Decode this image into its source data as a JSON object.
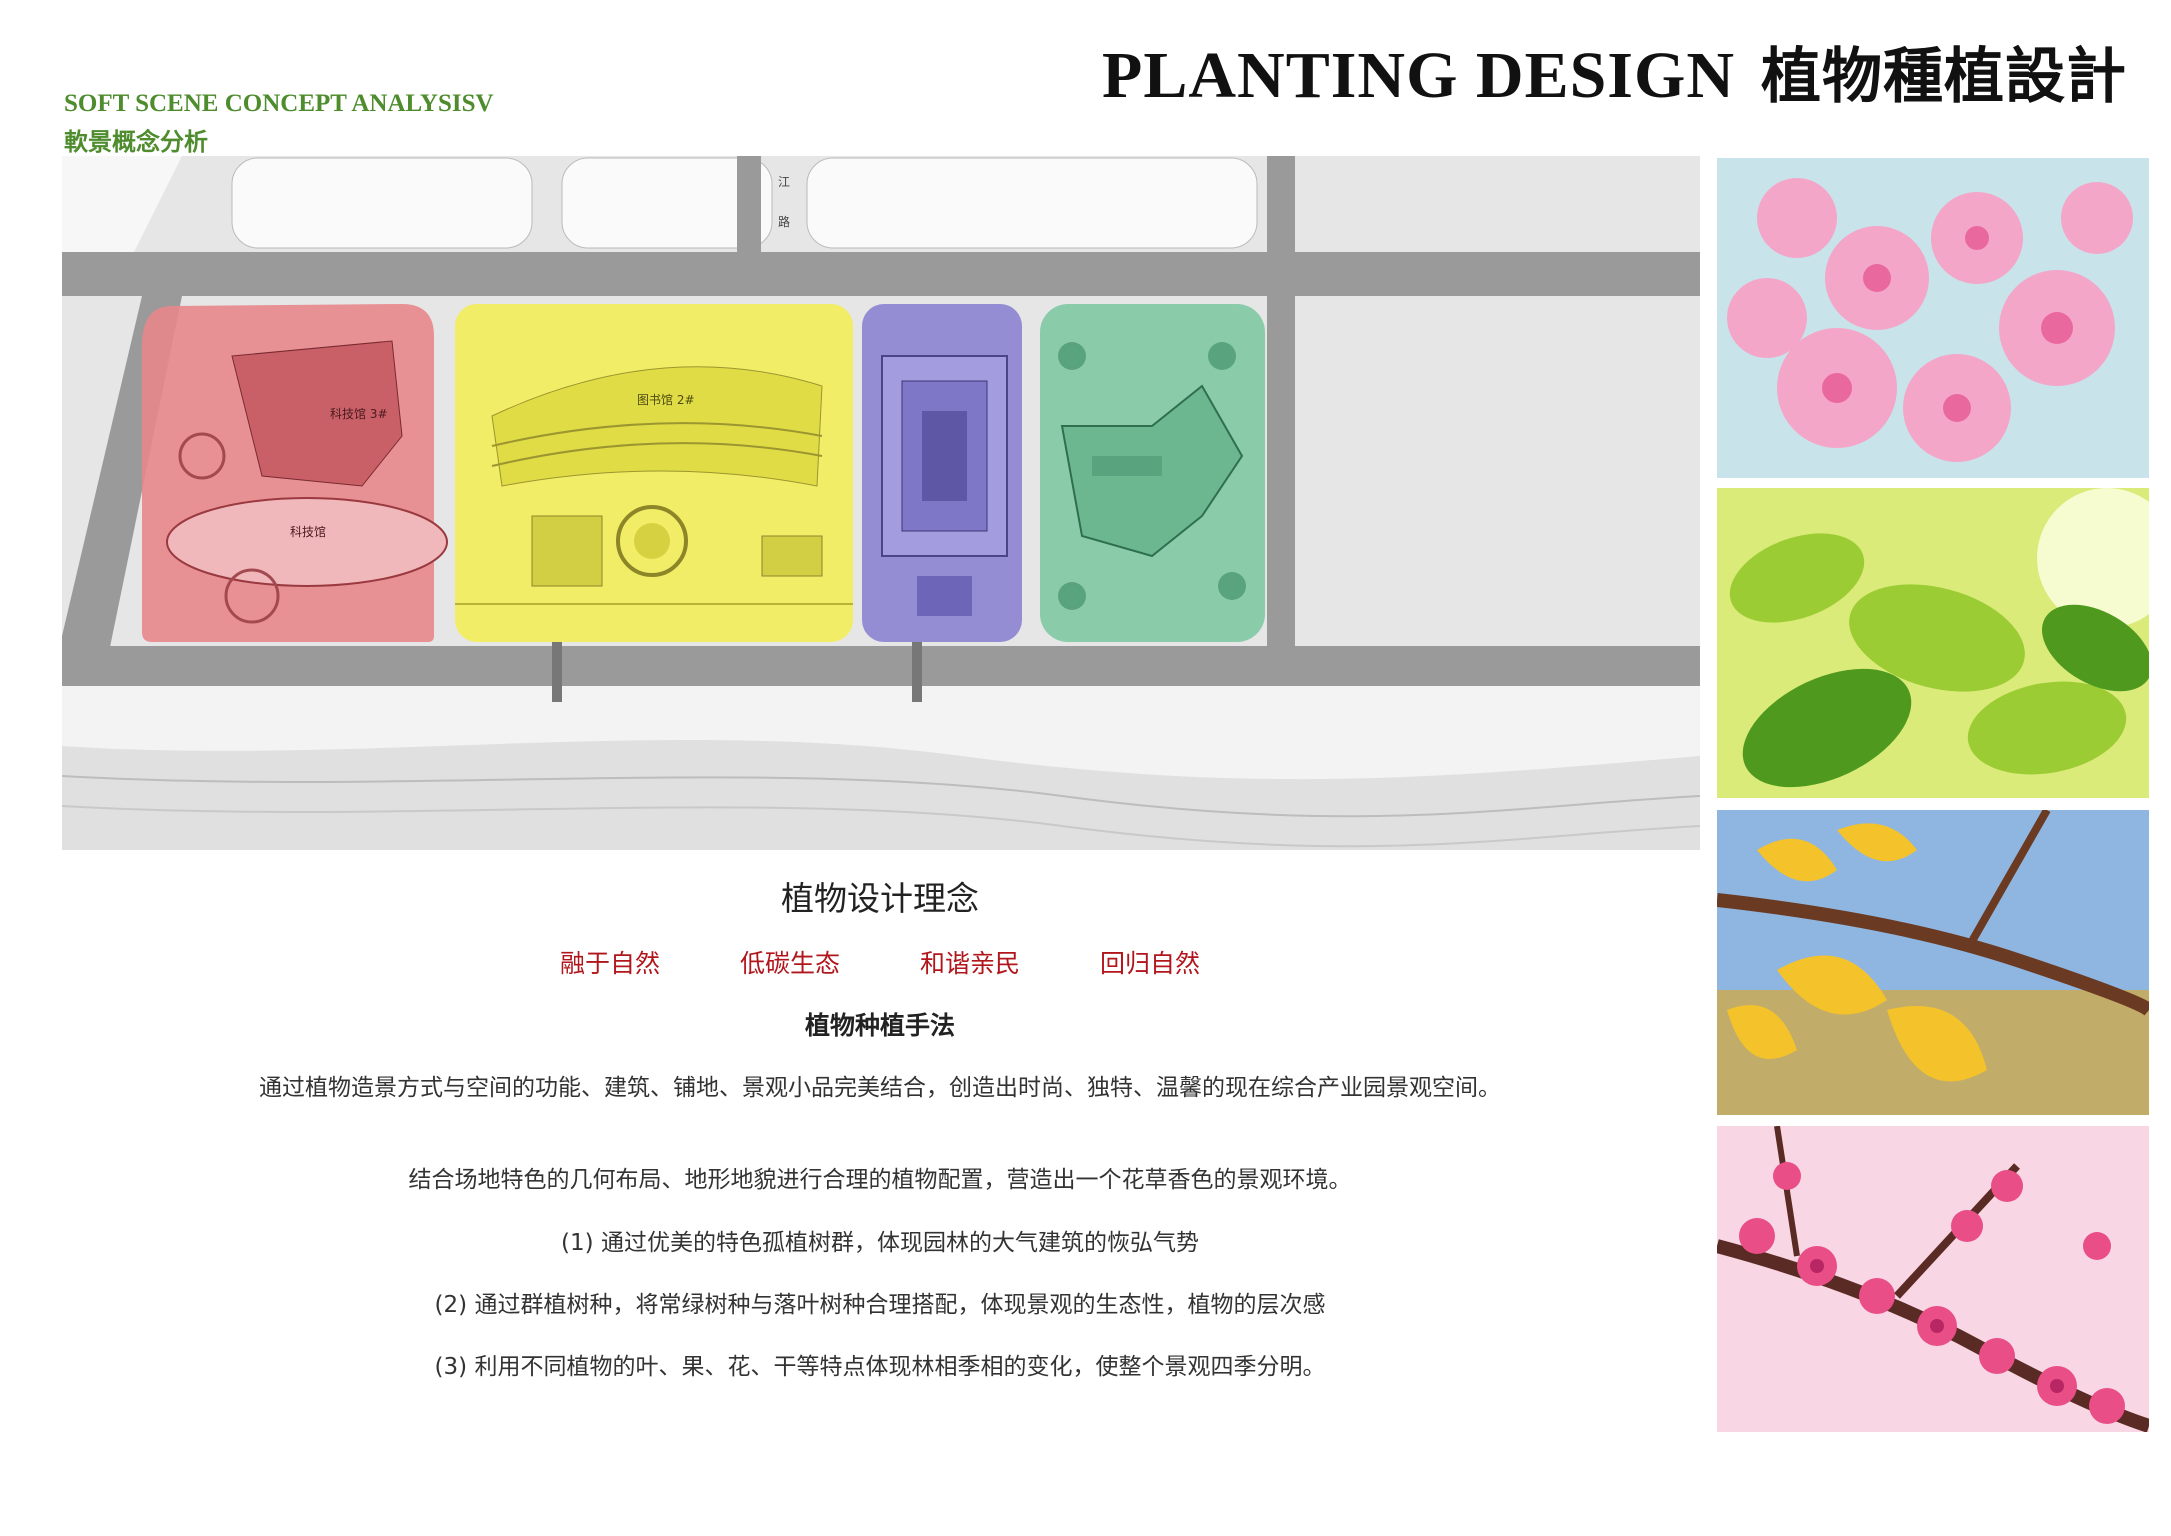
{
  "header": {
    "title_en": "PLANTING DESIGN",
    "title_zh": "植物種植設計",
    "subtitle_en": "SOFT SCENE CONCEPT ANALYSISV",
    "subtitle_zh": "軟景概念分析"
  },
  "plan": {
    "zones": [
      {
        "name": "red",
        "color": "#e8878c"
      },
      {
        "name": "yellow",
        "color": "#f2ee5b"
      },
      {
        "name": "purple",
        "color": "#8d86d3"
      },
      {
        "name": "green",
        "color": "#7fc9a3"
      }
    ],
    "labels": {
      "tech_hall_top": "科技馆 3#",
      "tech_hall_bottom": "科技馆",
      "library": "图书馆 2#",
      "road": "江",
      "road2": "路"
    }
  },
  "photos": [
    {
      "name": "cherry-blossom",
      "colors": [
        "#f4a6c9",
        "#e9699f",
        "#c9e3ea"
      ]
    },
    {
      "name": "green-leaves",
      "colors": [
        "#9ccc33",
        "#4f9a1e",
        "#eef8b0"
      ]
    },
    {
      "name": "ginkgo-leaves",
      "colors": [
        "#f4c22a",
        "#e5a51a",
        "#8fb6e0"
      ]
    },
    {
      "name": "plum-blossom",
      "colors": [
        "#e94e86",
        "#b82763",
        "#f8d6e3"
      ]
    }
  ],
  "concept": {
    "title": "植物设计理念",
    "principles": [
      "融于自然",
      "低碳生态",
      "和谐亲民",
      "回归自然"
    ],
    "method_title": "植物种植手法",
    "para1": "通过植物造景方式与空间的功能、建筑、铺地、景观小品完美结合，创造出时尚、独特、温馨的现在综合产业园景观空间。",
    "para2": "结合场地特色的几何布局、地形地貌进行合理的植物配置，营造出一个花草香色的景观环境。",
    "item1": "(1)  通过优美的特色孤植树群，体现园林的大气建筑的恢弘气势",
    "item2": "(2)  通过群植树种，将常绿树种与落叶树种合理搭配，体现景观的生态性，植物的层次感",
    "item3": "(3)  利用不同植物的叶、果、花、干等特点体现林相季相的变化，使整个景观四季分明。"
  }
}
